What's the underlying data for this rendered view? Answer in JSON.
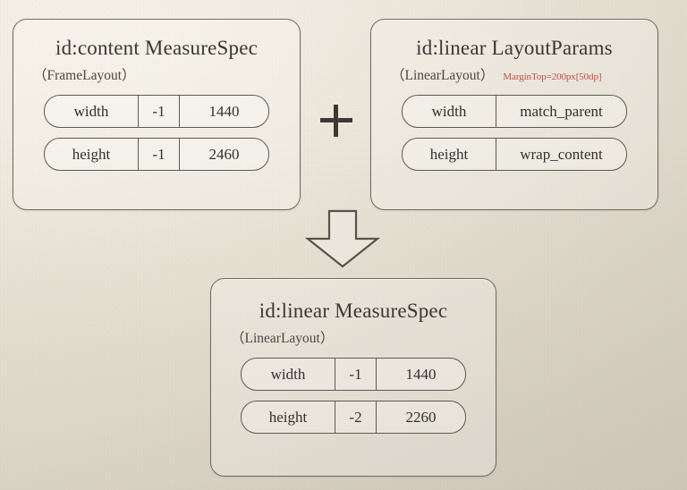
{
  "diagram": {
    "type": "measurespec-resolution-diagram",
    "operator": "+",
    "flow": "down-arrow",
    "colors": {
      "background": "#f2efe8",
      "border": "#6f6a62",
      "text": "#33302d",
      "note_accent": "#c24b45"
    }
  },
  "panels": {
    "left": {
      "title": "id:content MeasureSpec",
      "subtitle": "（FrameLayout）",
      "note": "",
      "rows": [
        {
          "label": "width",
          "mode": "-1",
          "value": "1440"
        },
        {
          "label": "height",
          "mode": "-1",
          "value": "2460"
        }
      ]
    },
    "right": {
      "title": "id:linear  LayoutParams",
      "subtitle": "（LinearLayout）",
      "note": "MarginTop=200px[50dp]",
      "rows": [
        {
          "label": "width",
          "value": "match_parent"
        },
        {
          "label": "height",
          "value": "wrap_content"
        }
      ]
    },
    "bottom": {
      "title": "id:linear  MeasureSpec",
      "subtitle": "（LinearLayout）",
      "note": "",
      "rows": [
        {
          "label": "width",
          "mode": "-1",
          "value": "1440"
        },
        {
          "label": "height",
          "mode": "-2",
          "value": "2260"
        }
      ]
    }
  },
  "connectors": {
    "plus_label": "+",
    "arrow_label": "results-in"
  }
}
